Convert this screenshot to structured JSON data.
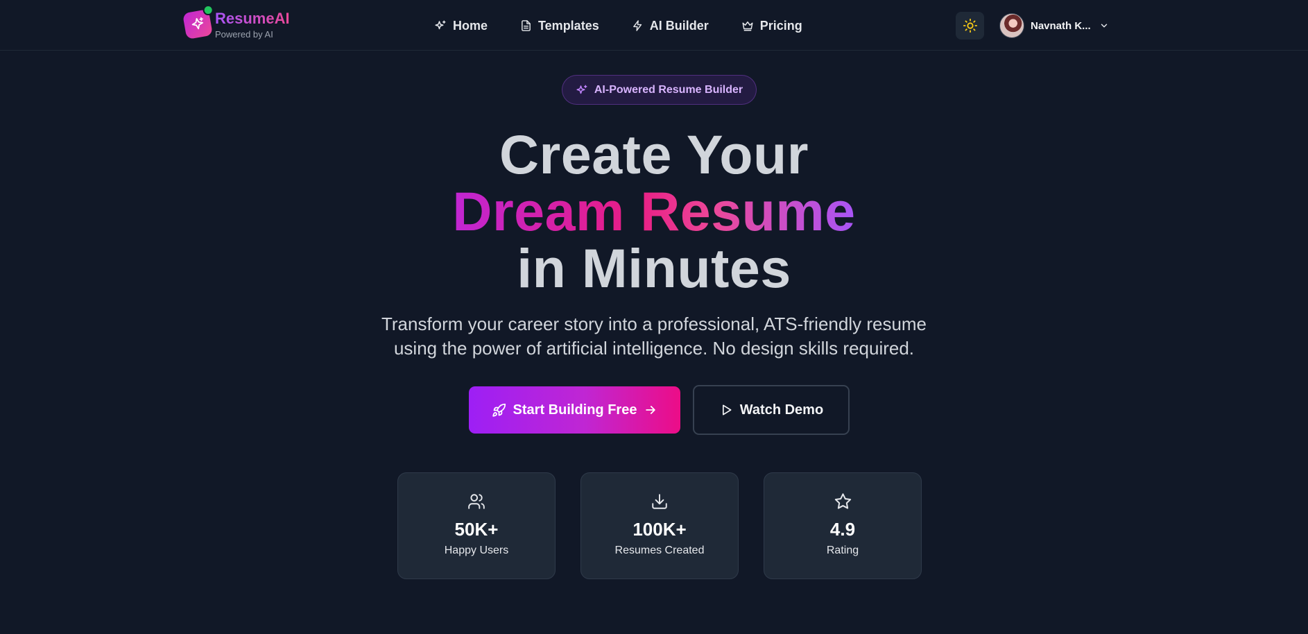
{
  "brand": {
    "name": "ResumeAI",
    "tagline": "Powered by AI"
  },
  "nav": {
    "items": [
      {
        "label": "Home",
        "icon": "sparkles-icon"
      },
      {
        "label": "Templates",
        "icon": "document-icon"
      },
      {
        "label": "AI Builder",
        "icon": "zap-icon"
      },
      {
        "label": "Pricing",
        "icon": "crown-icon"
      }
    ]
  },
  "header": {
    "theme_icon": "sun-icon",
    "user_name": "Navnath K..."
  },
  "hero": {
    "badge": "AI-Powered Resume Builder",
    "headline_line1": "Create Your",
    "headline_line2": "Dream Resume",
    "headline_line3": "in Minutes",
    "subtitle_line1": "Transform your career story into a professional, ATS-friendly resume",
    "subtitle_line2": "using the power of artificial intelligence. No design skills required.",
    "primary_cta": "Start Building Free",
    "secondary_cta": "Watch Demo"
  },
  "stats": [
    {
      "value": "50K+",
      "label": "Happy Users",
      "icon": "users-icon"
    },
    {
      "value": "100K+",
      "label": "Resumes Created",
      "icon": "download-icon"
    },
    {
      "value": "4.9",
      "label": "Rating",
      "icon": "star-icon"
    }
  ],
  "colors": {
    "background": "#111827",
    "card": "#1f2937",
    "accent_purple": "#a855f7",
    "accent_pink": "#ec4899",
    "online": "#22c55e",
    "sun": "#facc15"
  }
}
